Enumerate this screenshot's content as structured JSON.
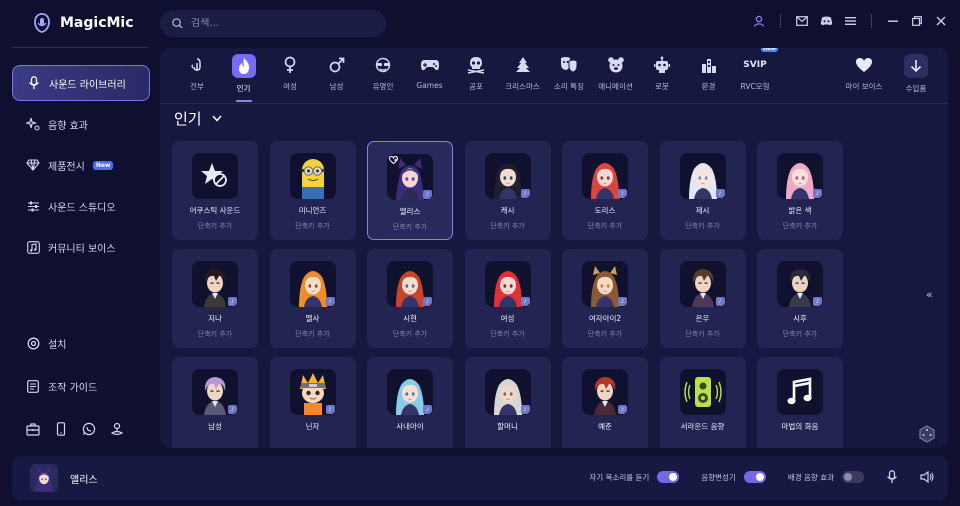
{
  "app": {
    "title": "MagicMic"
  },
  "search": {
    "placeholder": "검색..."
  },
  "sidebar": {
    "items": [
      {
        "label": "사운드 라이브러리",
        "icon": "mic-icon",
        "active": true
      },
      {
        "label": "음향 효과",
        "icon": "sparkle-icon"
      },
      {
        "label": "제품전시",
        "icon": "diamond-icon",
        "badge": "New"
      },
      {
        "label": "사운드 스튜디오",
        "icon": "sliders-icon"
      },
      {
        "label": "커뮤니티 보이스",
        "icon": "music-note-icon"
      }
    ],
    "bottom_items": [
      {
        "label": "설치",
        "icon": "settings-icon"
      },
      {
        "label": "조작 가이드",
        "icon": "guide-icon"
      }
    ]
  },
  "tabs": [
    {
      "label": "전부",
      "icon": "all-icon"
    },
    {
      "label": "인기",
      "icon": "fire-icon",
      "active": true
    },
    {
      "label": "여성",
      "icon": "female-icon"
    },
    {
      "label": "남성",
      "icon": "male-icon"
    },
    {
      "label": "유명인",
      "icon": "celebrity-icon"
    },
    {
      "label": "Games",
      "icon": "gamepad-icon"
    },
    {
      "label": "공포",
      "icon": "skull-icon"
    },
    {
      "label": "크리스마스",
      "icon": "tree-icon"
    },
    {
      "label": "소리 특징",
      "icon": "mask-icon"
    },
    {
      "label": "애니메이션",
      "icon": "bear-icon"
    },
    {
      "label": "로봇",
      "icon": "robot-icon"
    },
    {
      "label": "환경",
      "icon": "city-icon"
    },
    {
      "label": "RVC모형",
      "icon": "svip-icon",
      "top_text": "SVIP",
      "badge": "new"
    }
  ],
  "right_tabs": [
    {
      "label": "마이 보이스",
      "icon": "heart-icon"
    },
    {
      "label": "수입품",
      "icon": "download-icon"
    }
  ],
  "section": {
    "title": "인기"
  },
  "voices": [
    {
      "name": "어쿠스틱 사운드",
      "sub": "단축키 추가",
      "kind": "star"
    },
    {
      "name": "미니언즈",
      "sub": "단축키 추가",
      "kind": "minion"
    },
    {
      "name": "앨리스",
      "sub": "단축키 추가",
      "kind": "alice",
      "selected": true
    },
    {
      "name": "케시",
      "sub": "단축키 추가",
      "kind": "girl-dark"
    },
    {
      "name": "도리스",
      "sub": "단축키 추가",
      "kind": "girl-red"
    },
    {
      "name": "제시",
      "sub": "단축키 추가",
      "kind": "girl-white"
    },
    {
      "name": "밝은 색",
      "sub": "단축키 추가",
      "kind": "girl-pink"
    },
    {
      "name": "지나",
      "sub": "단축키 추가",
      "kind": "man-dark"
    },
    {
      "name": "멜사",
      "sub": "단축키 추가",
      "kind": "girl-orange"
    },
    {
      "name": "시현",
      "sub": "단축키 추가",
      "kind": "girl-redhead"
    },
    {
      "name": "여성",
      "sub": "단축키 추가",
      "kind": "girl-scarlet"
    },
    {
      "name": "여자아이2",
      "sub": "단축키 추가",
      "kind": "girl-fox"
    },
    {
      "name": "은우",
      "sub": "단축키 추가",
      "kind": "man-brown"
    },
    {
      "name": "시후",
      "sub": "단축키 추가",
      "kind": "man-black"
    },
    {
      "name": "남성",
      "sub": "",
      "kind": "man-lilac"
    },
    {
      "name": "닌자",
      "sub": "",
      "kind": "ninja"
    },
    {
      "name": "사내아이",
      "sub": "",
      "kind": "boy-blue"
    },
    {
      "name": "할머니",
      "sub": "",
      "kind": "grandma"
    },
    {
      "name": "예준",
      "sub": "",
      "kind": "man-red"
    },
    {
      "name": "서라운드 음향",
      "sub": "",
      "kind": "speaker"
    },
    {
      "name": "마법의 화음",
      "sub": "",
      "kind": "music"
    }
  ],
  "bottom_bar": {
    "current_voice": "앨리스",
    "toggle1_label": "자기 목소리를 듣기",
    "toggle1_on": true,
    "toggle2_label": "음향변성기",
    "toggle2_on": true,
    "toggle3_label": "배경 음향 효과",
    "toggle3_on": false
  },
  "colors": {
    "accent": "#7a6cf0",
    "background": "#0f1030",
    "panel": "#171840",
    "card": "#232451"
  }
}
